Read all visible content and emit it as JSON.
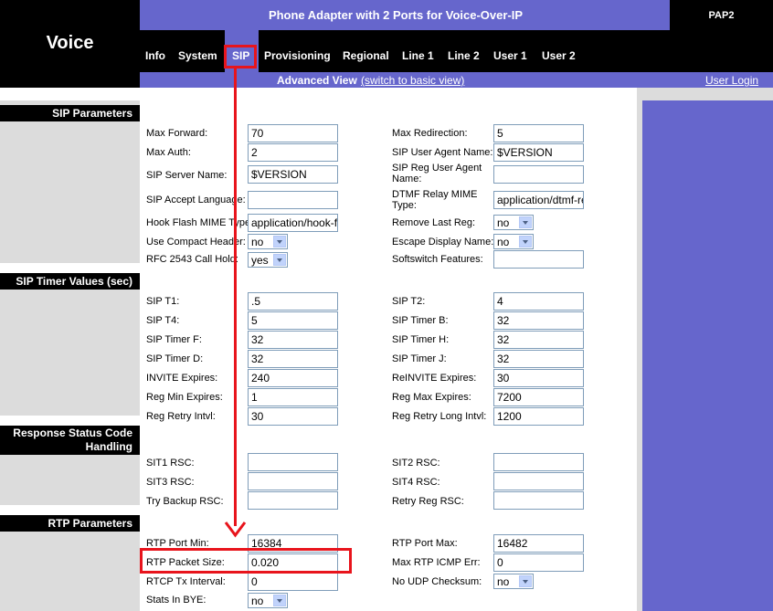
{
  "brand": "Voice",
  "banner_title": "Phone Adapter with 2 Ports for Voice-Over-IP",
  "model": "PAP2",
  "nav": [
    "Info",
    "System",
    "SIP",
    "Provisioning",
    "Regional",
    "Line 1",
    "Line 2",
    "User 1",
    "User 2"
  ],
  "view": {
    "mode": "Advanced View",
    "switch": "(switch to basic view)",
    "login": "User Login"
  },
  "sections": {
    "sip": "SIP Parameters",
    "timer": "SIP Timer Values (sec)",
    "rsc": "Response Status Code Handling",
    "rtp": "RTP Parameters"
  },
  "sip_params": {
    "max_forward": {
      "label": "Max Forward:",
      "value": "70"
    },
    "max_redirection": {
      "label": "Max Redirection:",
      "value": "5"
    },
    "max_auth": {
      "label": "Max Auth:",
      "value": "2"
    },
    "sip_user_agent": {
      "label": "SIP User Agent Name:",
      "value": "$VERSION"
    },
    "sip_server_name": {
      "label": "SIP Server Name:",
      "value": "$VERSION"
    },
    "sip_reg_user_agent": {
      "label": "SIP Reg User Agent Name:",
      "value": ""
    },
    "sip_accept_language": {
      "label": "SIP Accept Language:",
      "value": ""
    },
    "dtmf_relay_mime": {
      "label": "DTMF Relay MIME Type:",
      "value": "application/dtmf-relay"
    },
    "hook_flash_mime": {
      "label": "Hook Flash MIME Type:",
      "value": "application/hook-flash"
    },
    "remove_last_reg": {
      "label": "Remove Last Reg:",
      "value": "no"
    },
    "use_compact_header": {
      "label": "Use Compact Header:",
      "value": "no"
    },
    "escape_display_name": {
      "label": "Escape Display Name:",
      "value": "no"
    },
    "rfc2543_call_hold": {
      "label": "RFC 2543 Call Hold:",
      "value": "yes"
    },
    "softswitch_features": {
      "label": "Softswitch Features:",
      "value": ""
    }
  },
  "timers": {
    "t1": {
      "label": "SIP T1:",
      "value": ".5"
    },
    "t2": {
      "label": "SIP T2:",
      "value": "4"
    },
    "t4": {
      "label": "SIP T4:",
      "value": "5"
    },
    "timer_b": {
      "label": "SIP Timer B:",
      "value": "32"
    },
    "timer_f": {
      "label": "SIP Timer F:",
      "value": "32"
    },
    "timer_h": {
      "label": "SIP Timer H:",
      "value": "32"
    },
    "timer_d": {
      "label": "SIP Timer D:",
      "value": "32"
    },
    "timer_j": {
      "label": "SIP Timer J:",
      "value": "32"
    },
    "invite_expires": {
      "label": "INVITE Expires:",
      "value": "240"
    },
    "reinvite_expires": {
      "label": "ReINVITE Expires:",
      "value": "30"
    },
    "reg_min_expires": {
      "label": "Reg Min Expires:",
      "value": "1"
    },
    "reg_max_expires": {
      "label": "Reg Max Expires:",
      "value": "7200"
    },
    "reg_retry_intvl": {
      "label": "Reg Retry Intvl:",
      "value": "30"
    },
    "reg_retry_long_intvl": {
      "label": "Reg Retry Long Intvl:",
      "value": "1200"
    }
  },
  "rsc": {
    "sit1": {
      "label": "SIT1 RSC:",
      "value": ""
    },
    "sit2": {
      "label": "SIT2 RSC:",
      "value": ""
    },
    "sit3": {
      "label": "SIT3 RSC:",
      "value": ""
    },
    "sit4": {
      "label": "SIT4 RSC:",
      "value": ""
    },
    "try_backup": {
      "label": "Try Backup RSC:",
      "value": ""
    },
    "retry_reg": {
      "label": "Retry Reg RSC:",
      "value": ""
    }
  },
  "rtp": {
    "port_min": {
      "label": "RTP Port Min:",
      "value": "16384"
    },
    "port_max": {
      "label": "RTP Port Max:",
      "value": "16482"
    },
    "packet_size": {
      "label": "RTP Packet Size:",
      "value": "0.020"
    },
    "max_icmp_err": {
      "label": "Max RTP ICMP Err:",
      "value": "0"
    },
    "rtcp_tx_interval": {
      "label": "RTCP Tx Interval:",
      "value": "0"
    },
    "no_udp_checksum": {
      "label": "No UDP Checksum:",
      "value": "no"
    },
    "stats_in_bye": {
      "label": "Stats In BYE:",
      "value": "no"
    }
  },
  "colors": {
    "accent": "#6666cc",
    "annotation": "#e8141c",
    "panel": "#dcdcdc"
  }
}
